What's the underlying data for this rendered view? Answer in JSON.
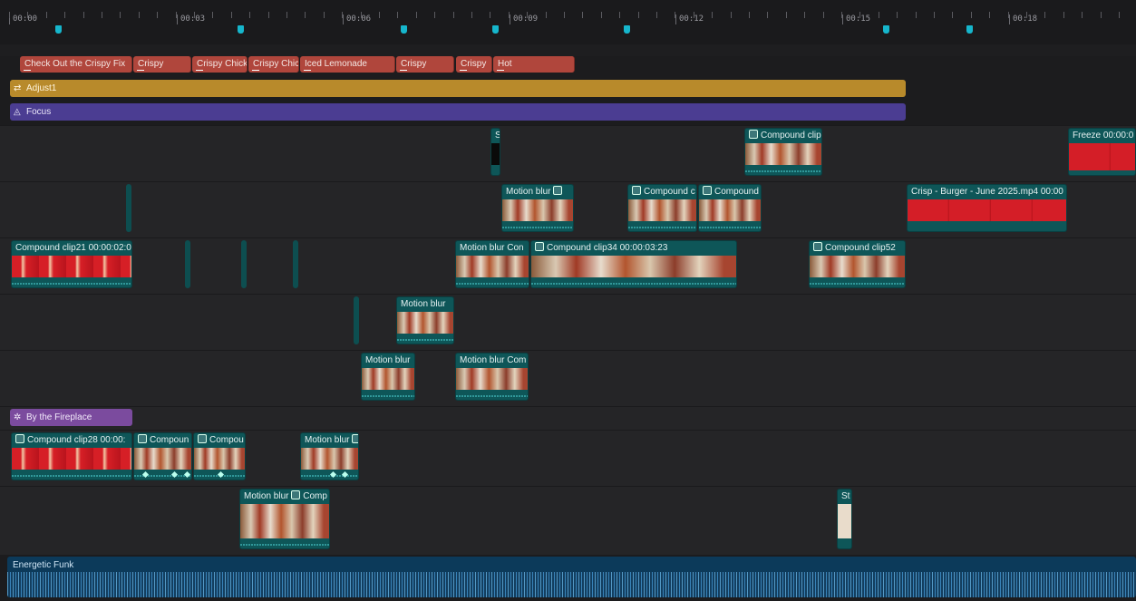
{
  "ruler": {
    "labels": [
      "00:00",
      "00:03",
      "00:06",
      "00:09",
      "00:12",
      "00:15",
      "00:18"
    ]
  },
  "text_clips": [
    "Check Out the Crispy Fix",
    "Crispy",
    "Crispy Chicke",
    "Crispy Chic",
    "Iced Lemonade",
    "Crispy",
    "Crispy",
    "Hot"
  ],
  "adjust": {
    "label": "Adjust1",
    "icon": "sliders-icon"
  },
  "focus": {
    "label": "Focus",
    "icon": "focus-icon"
  },
  "fireplace": {
    "label": "By the Fireplace",
    "icon": "sparkle-icon"
  },
  "clips": {
    "s_small": "S",
    "compound_top": "Compound clip",
    "freeze": "Freeze  00:00:0",
    "motion_blur": "Motion blur",
    "compound_c": "Compound c",
    "compound_plain": "Compound",
    "crisp_burger": "Crisp - Burger - June 2025.mp4  00:00",
    "compound21": "Compound clip21  00:00:02:0",
    "motion_blur_com": "Motion blur  Con",
    "compound34": "Compound clip34  00:00:03:23",
    "compound52": "Compound clip52",
    "motion_blur_com2": "Motion blur  Com",
    "compound28": "Compound clip28  00:00:",
    "compoun": "Compoun",
    "compou": "Compou",
    "motion_blur_short": "Motion blur",
    "comp": "Comp",
    "st": "St"
  },
  "audio": {
    "label": "Energetic Funk"
  },
  "colors": {
    "accent": "#16b6cc",
    "text_clip": "#b0463c",
    "video_clip": "#0e5658",
    "adjust": "#b88a2b",
    "focus": "#4b3d92",
    "fx": "#7b4b9e",
    "audio": "#0c3a5a"
  }
}
